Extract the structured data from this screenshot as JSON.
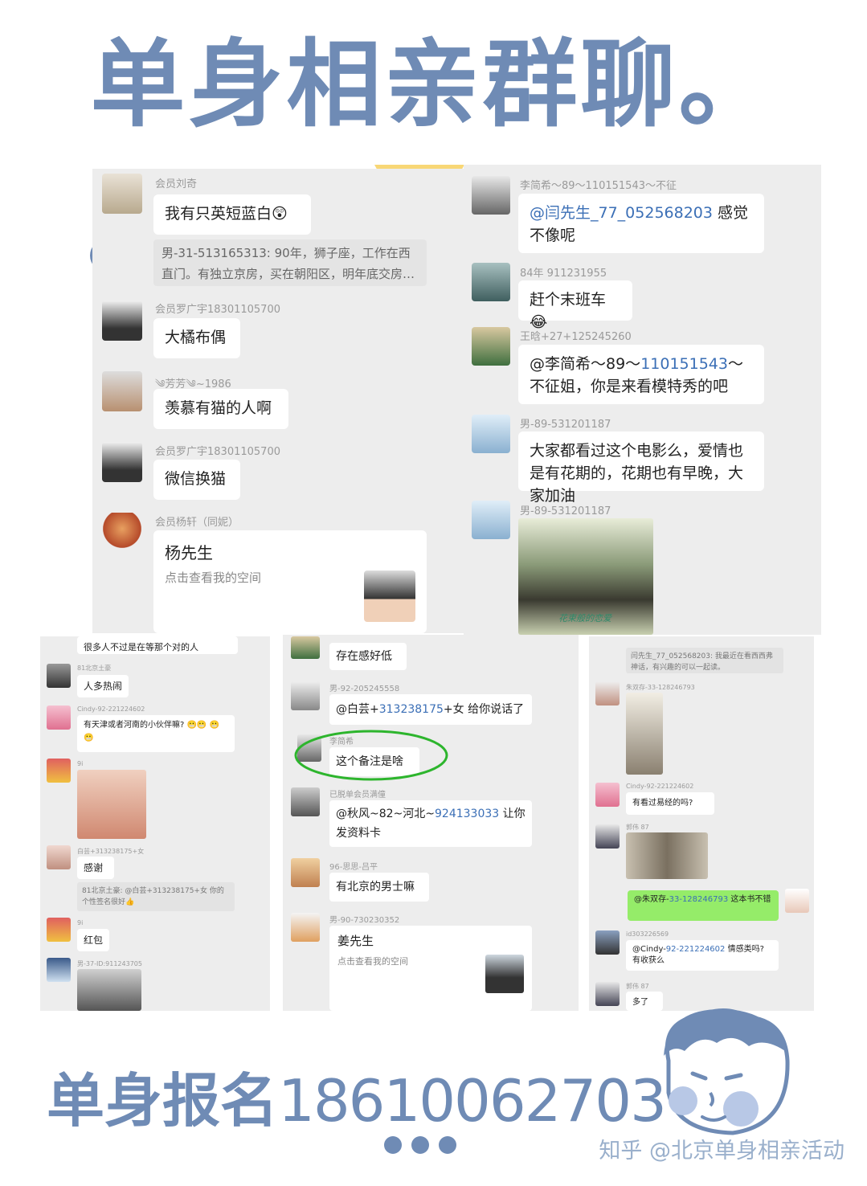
{
  "colors": {
    "accent": "#6f8bb5",
    "panel": "#ededed",
    "link": "#3b6fb6",
    "wechat_green": "#95ec69",
    "highlight_yellow": "#f8d776"
  },
  "title": "单身相亲群聊。",
  "left_chat": [
    {
      "name": "会员刘奇",
      "text": "我有只英短蓝白😲"
    },
    {
      "quote": "男-31-513165313: 90年，狮子座，工作在西直门。有独立京房，买在朝阳区，明年底交房…"
    },
    {
      "name": "会员罗广宇18301105700",
      "text": "大橘布偶"
    },
    {
      "name": "༄芳芳༄~1986",
      "text": "羡慕有猫的人啊"
    },
    {
      "name": "会员罗广宇18301105700",
      "text": "微信换猫"
    },
    {
      "name": "会员杨轩（同妮）",
      "card_title": "杨先生",
      "card_sub": "点击查看我的空间"
    }
  ],
  "right_chat": [
    {
      "name": "李简希～89～110151543～不征",
      "text_a": "@闫先生_77_052568203",
      "text_b": " 感觉不像呢"
    },
    {
      "name": "84年 911231955",
      "text": "赶个末班车😂"
    },
    {
      "name": "王晗+27+125245260",
      "text_a": "@李简希～89～",
      "text_link": "110151543",
      "text_b": "～不征姐，你是来看模特秀的吧"
    },
    {
      "name": "男-89-531201187",
      "text": "大家都看过这个电影么，爱情也是有花期的，花期也有早晚，大家加油"
    },
    {
      "name": "男-89-531201187",
      "poster_text": "花束般的恋爱"
    }
  ],
  "bottom_left": [
    {
      "text": "很多人不过是在等那个对的人"
    },
    {
      "name": "81北京土豪",
      "text": "人多热闹"
    },
    {
      "name": "Cindy-92-221224602",
      "text": "有天津或者河南的小伙伴嘛? 😬😬 😬😬"
    },
    {
      "name": "9i"
    },
    {
      "name": "白芸+313238175+女",
      "text": "感谢"
    },
    {
      "quote": "81北京土豪: @白芸+313238175+女 你的个性签名很好👍"
    },
    {
      "name": "9i",
      "text": "红包"
    },
    {
      "name": "男-37-ID:911243705"
    }
  ],
  "bottom_mid": [
    {
      "text": "存在感好低"
    },
    {
      "name": "男-92-205245558",
      "text_a": "@白芸+",
      "text_link": "313238175",
      "text_b": "+女 给你说话了"
    },
    {
      "name": "李简希",
      "text": "这个备注是啥"
    },
    {
      "name": "已脱单会员满僮",
      "text_a": "@秋风~82~河北~",
      "text_link": "924133033",
      "text_b": " 让你发资料卡"
    },
    {
      "name": "96-思思-吕平",
      "text": "有北京的男士嘛"
    },
    {
      "name": "男-90-730230352",
      "card_title": "姜先生",
      "card_sub": "点击查看我的空间"
    }
  ],
  "bottom_right": [
    {
      "quote": "闫先生_77_052568203: 我最近在看西西弗神话，有兴趣的可以一起读。"
    },
    {
      "name": "朱双存-33-128246793"
    },
    {
      "name": "Cindy-92-221224602",
      "text": "有看过易经的吗?"
    },
    {
      "name": "郭伟 87"
    },
    {
      "text_a": "@朱双存-",
      "text_link": "33-128246793",
      "text_b": " 这本书不错"
    },
    {
      "name": "id303226569",
      "text_a": "@Cindy-",
      "text_link": "92-221224602",
      "text_b": " 情感类吗? 有收获么"
    },
    {
      "name": "郭伟 87",
      "text": "多了😂"
    }
  ],
  "footer": {
    "label": "单身报名",
    "number": "18610062703"
  },
  "watermark": "知乎 @北京单身相亲活动"
}
